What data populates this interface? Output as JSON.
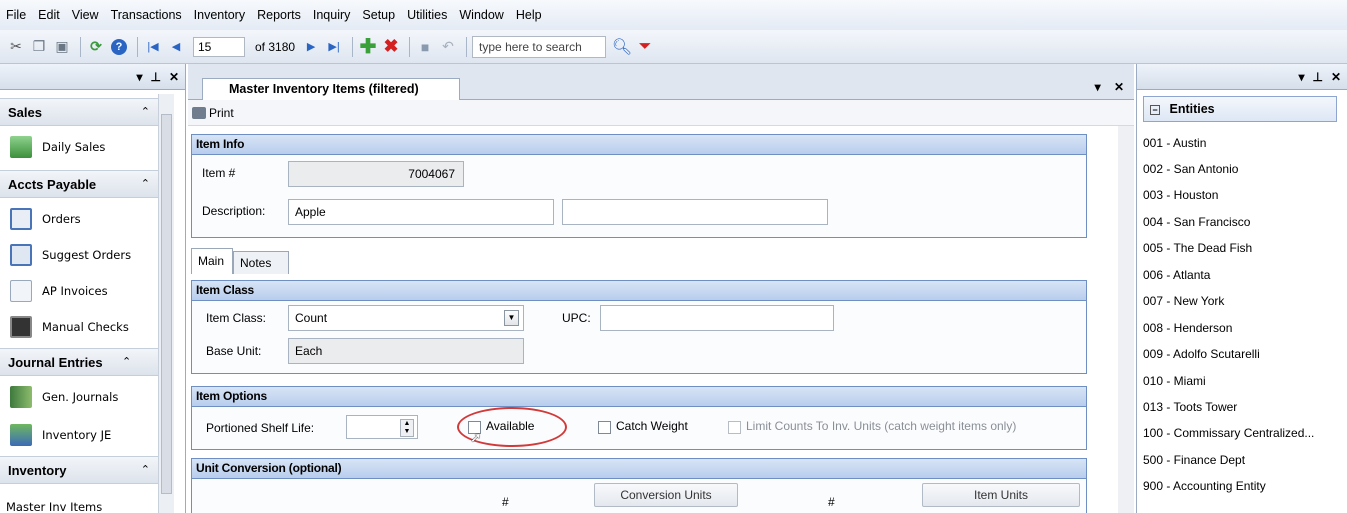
{
  "menu": [
    "File",
    "Edit",
    "View",
    "Transactions",
    "Inventory",
    "Reports",
    "Inquiry",
    "Setup",
    "Utilities",
    "Window",
    "Help"
  ],
  "toolbar": {
    "record_number": "15",
    "record_total": "of 3180",
    "search_placeholder": "type here to search"
  },
  "left_panel": {
    "caption_controls": [
      "▾",
      "⊥",
      "✕"
    ],
    "groups": [
      {
        "title": "Sales",
        "items": [
          {
            "label": "Daily Sales",
            "icon": "daily-sales-icon"
          }
        ]
      },
      {
        "title": "Accts Payable",
        "items": [
          {
            "label": "Orders",
            "icon": "orders-icon"
          },
          {
            "label": "Suggest Orders",
            "icon": "suggest-orders-icon"
          },
          {
            "label": "AP Invoices",
            "icon": "ap-invoices-icon"
          },
          {
            "label": "Manual Checks",
            "icon": "manual-checks-icon"
          }
        ]
      },
      {
        "title": "Journal Entries",
        "items": [
          {
            "label": "Gen. Journals",
            "icon": "gen-journals-icon"
          },
          {
            "label": "Inventory JE",
            "icon": "inventory-je-icon"
          }
        ]
      },
      {
        "title": "Inventory",
        "items": [
          {
            "label": "Master Inv Items",
            "icon": "master-inv-items-icon"
          }
        ]
      }
    ]
  },
  "document": {
    "tab_title": "Master Inventory Items (filtered)",
    "print_label": "Print",
    "item_info": {
      "title": "Item Info",
      "item_no_label": "Item #",
      "item_no_value": "7004067",
      "description_label": "Description:",
      "description_value": "Apple",
      "description2_value": ""
    },
    "tabs": [
      "Main",
      "Notes"
    ],
    "item_class": {
      "title": "Item Class",
      "class_label": "Item Class:",
      "class_value": "Count",
      "upc_label": "UPC:",
      "upc_value": "",
      "base_unit_label": "Base Unit:",
      "base_unit_value": "Each"
    },
    "item_options": {
      "title": "Item Options",
      "shelf_life_label": "Portioned Shelf Life:",
      "shelf_life_value": "",
      "available_label": "Available",
      "catch_weight_label": "Catch Weight",
      "limit_counts_label": "Limit Counts To Inv. Units (catch weight items only)"
    },
    "unit_conversion": {
      "title": "Unit Conversion (optional)",
      "hash1": "#",
      "hash2": "#",
      "conversion_units_label": "Conversion Units",
      "item_units_label": "Item Units"
    }
  },
  "right_panel": {
    "header": "Entities",
    "entities": [
      "001 - Austin",
      "002 - San Antonio",
      "003 - Houston",
      "004 - San Francisco",
      "005 - The Dead Fish",
      "006 - Atlanta",
      "007 - New York",
      "008 - Henderson",
      "009 - Adolfo Scutarelli",
      "010 - Miami",
      "013 - Toots Tower",
      "100 - Commissary Centralized...",
      "500 - Finance Dept",
      "900 - Accounting Entity"
    ]
  },
  "colors": {
    "group_border": "#6f8fc2",
    "highlight_circle": "#d23a3a"
  }
}
